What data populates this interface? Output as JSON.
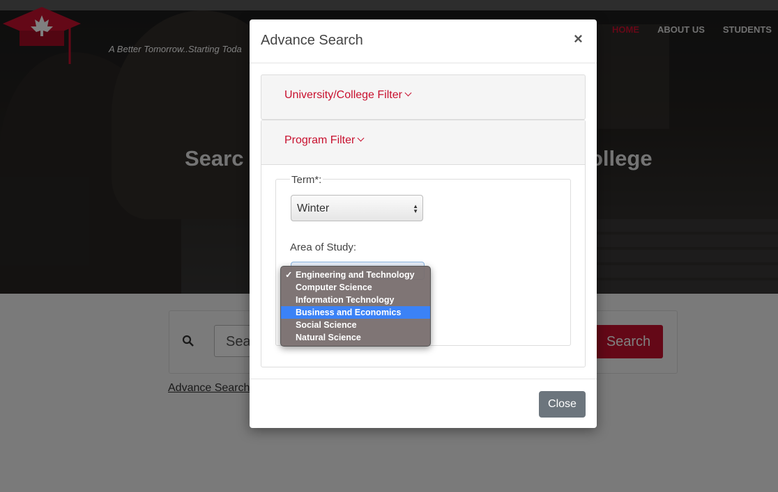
{
  "site": {
    "tagline": "A Better Tomorrow..Starting Toda",
    "nav": [
      "HOME",
      "ABOUT US",
      "STUDENTS"
    ],
    "hero_title_left": "Searc",
    "hero_title_right": "ollege",
    "search_placeholder": "Sea",
    "search_button": "Search",
    "advance_link": "Advance Search"
  },
  "modal": {
    "title": "Advance Search",
    "close_x": "×",
    "panel_university": "University/College Filter",
    "panel_program": "Program Filter",
    "term_label": "Term*:",
    "term_value": "Winter",
    "area_label": "Area of Study:",
    "close_button": "Close"
  },
  "dropdown": {
    "checkmark": "✓",
    "options": [
      "Engineering and Technology",
      "Computer Science",
      "Information Technology",
      "Business and Economics",
      "Social Science",
      "Natural Science"
    ],
    "selected": "Engineering and Technology",
    "highlighted": "Business and Economics"
  },
  "colors": {
    "accent": "#c8102e",
    "highlight": "#3b82f6",
    "close_button": "#6c757d"
  }
}
